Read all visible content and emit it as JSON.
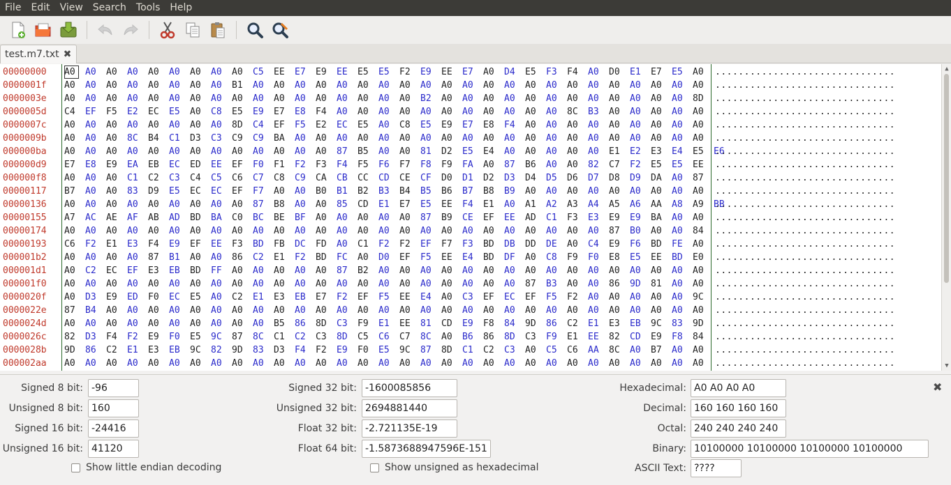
{
  "menu": [
    "File",
    "Edit",
    "View",
    "Search",
    "Tools",
    "Help"
  ],
  "toolbar": {
    "icons": [
      "new-file-icon",
      "open-file-icon",
      "save-file-icon",
      "undo-icon",
      "redo-icon",
      "cut-icon",
      "copy-icon",
      "paste-icon",
      "find-icon",
      "find-replace-icon"
    ]
  },
  "tab": {
    "title": "test.m7.txt",
    "close_glyph": "✖"
  },
  "hex": {
    "rows": [
      {
        "offset": "00000000",
        "bytes": "A0 A0 A0 A0 A0 A0 A0 A0 A0 C5 EE E7 E9 EE E5 E5 F2 E9 EE E7 A0 D4 E5 F3 F4 A0 D0 E1 E7 E5 A0",
        "ascii": "..............................."
      },
      {
        "offset": "0000001f",
        "bytes": "A0 A0 A0 A0 A0 A0 A0 A0 B1 A0 A0 A0 A0 A0 A0 A0 A0 A0 A0 A0 A0 A0 A0 A0 A0 A0 A0 A0 A0 A0 A0",
        "ascii": "..............................."
      },
      {
        "offset": "0000003e",
        "bytes": "A0 A0 A0 A0 A0 A0 A0 A0 A0 A0 A0 A0 A0 A0 A0 A0 A0 B2 A0 A0 A0 A0 A0 A0 A0 A0 A0 A0 A0 A0 8D",
        "ascii": "..............................."
      },
      {
        "offset": "0000005d",
        "bytes": "C4 EF F5 E2 EC E5 A0 C8 E5 E9 E7 E8 F4 A0 A0 A0 A0 A0 A0 A0 A0 A0 A0 A0 8C B3 A0 A0 A0 A0 A0",
        "ascii": "..............................."
      },
      {
        "offset": "0000007c",
        "bytes": "A0 A0 A0 A0 A0 A0 A0 A0 8D C4 EF F5 E2 EC E5 A0 C8 E5 E9 E7 E8 F4 A0 A0 A0 A0 A0 A0 A0 A0 A0",
        "ascii": "..............................."
      },
      {
        "offset": "0000009b",
        "bytes": "A0 A0 A0 8C B4 C1 D3 C3 C9 C9 BA A0 A0 A0 A0 A0 A0 A0 A0 A0 A0 A0 A0 A0 A0 A0 A0 A0 A0 A0 A0",
        "ascii": "..............................."
      },
      {
        "offset": "000000ba",
        "bytes": "A0 A0 A0 A0 A0 A0 A0 A0 A0 A0 A0 A0 A0 87 B5 A0 A0 81 D2 E5 E4 A0 A0 A0 A0 A0 E1 E2 E3 E4 E5 E6",
        "ascii": "..............................."
      },
      {
        "offset": "000000d9",
        "bytes": "E7 E8 E9 EA EB EC ED EE EF F0 F1 F2 F3 F4 F5 F6 F7 F8 F9 FA A0 87 B6 A0 A0 82 C7 F2 E5 E5 EE",
        "ascii": "..............................."
      },
      {
        "offset": "000000f8",
        "bytes": "A0 A0 A0 C1 C2 C3 C4 C5 C6 C7 C8 C9 CA CB CC CD CE CF D0 D1 D2 D3 D4 D5 D6 D7 D8 D9 DA A0 87",
        "ascii": "..............................."
      },
      {
        "offset": "00000117",
        "bytes": "B7 A0 A0 83 D9 E5 EC EC EF F7 A0 A0 B0 B1 B2 B3 B4 B5 B6 B7 B8 B9 A0 A0 A0 A0 A0 A0 A0 A0 A0",
        "ascii": "..............................."
      },
      {
        "offset": "00000136",
        "bytes": "A0 A0 A0 A0 A0 A0 A0 A0 A0 87 B8 A0 A0 85 CD E1 E7 E5 EE F4 E1 A0 A1 A2 A3 A4 A5 A6 AA A8 A9 BB",
        "ascii": "..............................."
      },
      {
        "offset": "00000155",
        "bytes": "A7 AC AE AF AB AD BD BA C0 BC BE BF A0 A0 A0 A0 A0 87 B9 CE EF EE AD C1 F3 E3 E9 E9 BA A0 A0",
        "ascii": "..............................."
      },
      {
        "offset": "00000174",
        "bytes": "A0 A0 A0 A0 A0 A0 A0 A0 A0 A0 A0 A0 A0 A0 A0 A0 A0 A0 A0 A0 A0 A0 A0 A0 A0 A0 87 B0 A0 A0 84",
        "ascii": "..............................."
      },
      {
        "offset": "00000193",
        "bytes": "C6 F2 E1 E3 F4 E9 EF EE F3 BD FB DC FD A0 C1 F2 F2 EF F7 F3 BD DB DD DE A0 C4 E9 F6 BD FE A0",
        "ascii": "..............................."
      },
      {
        "offset": "000001b2",
        "bytes": "A0 A0 A0 A0 87 B1 A0 A0 86 C2 E1 F2 BD FC A0 D0 EF F5 EE E4 BD DF A0 C8 F9 F0 E8 E5 EE BD E0",
        "ascii": "..............................."
      },
      {
        "offset": "000001d1",
        "bytes": "A0 C2 EC EF E3 EB BD FF A0 A0 A0 A0 A0 87 B2 A0 A0 A0 A0 A0 A0 A0 A0 A0 A0 A0 A0 A0 A0 A0 A0",
        "ascii": "..............................."
      },
      {
        "offset": "000001f0",
        "bytes": "A0 A0 A0 A0 A0 A0 A0 A0 A0 A0 A0 A0 A0 A0 A0 A0 A0 A0 A0 A0 A0 A0 87 B3 A0 A0 86 9D 81 A0 A0",
        "ascii": "..............................."
      },
      {
        "offset": "0000020f",
        "bytes": "A0 D3 E9 ED F0 EC E5 A0 C2 E1 E3 EB E7 F2 EF F5 EE E4 A0 C3 EF EC EF F5 F2 A0 A0 A0 A0 A0 9C",
        "ascii": "..............................."
      },
      {
        "offset": "0000022e",
        "bytes": "87 B4 A0 A0 A0 A0 A0 A0 A0 A0 A0 A0 A0 A0 A0 A0 A0 A0 A0 A0 A0 A0 A0 A0 A0 A0 A0 A0 A0 A0 A0",
        "ascii": "..............................."
      },
      {
        "offset": "0000024d",
        "bytes": "A0 A0 A0 A0 A0 A0 A0 A0 A0 A0 B5 86 8D C3 F9 E1 EE 81 CD E9 F8 84 9D 86 C2 E1 E3 EB 9C 83 9D",
        "ascii": "..............................."
      },
      {
        "offset": "0000026c",
        "bytes": "82 D3 F4 F2 E9 F0 E5 9C 87 8C C1 C2 C3 8D C5 C6 C7 8C A0 B6 86 8D C3 F9 E1 EE 82 CD E9 F8 84",
        "ascii": "..............................."
      },
      {
        "offset": "0000028b",
        "bytes": "9D 86 C2 E1 E3 EB 9C 82 9D 83 D3 F4 F2 E9 F0 E5 9C 87 8D C1 C2 C3 A0 C5 C6 AA 8C A0 B7 A0 A0",
        "ascii": "..............................."
      },
      {
        "offset": "000002aa",
        "bytes": "A0 A0 A0 A0 A0 A0 A0 A0 A0 A0 A0 A0 A0 A0 A0 A0 A0 A0 A0 A0 A0 A0 A0 A0 A0 A0 A0 A0 A0 A0 A0",
        "ascii": "..............................."
      }
    ]
  },
  "panel": {
    "signed8_label": "Signed 8 bit:",
    "signed8": "-96",
    "unsigned8_label": "Unsigned 8 bit:",
    "unsigned8": "160",
    "signed16_label": "Signed 16 bit:",
    "signed16": "-24416",
    "unsigned16_label": "Unsigned 16 bit:",
    "unsigned16": "41120",
    "signed32_label": "Signed 32 bit:",
    "signed32": "-1600085856",
    "unsigned32_label": "Unsigned 32 bit:",
    "unsigned32": "2694881440",
    "float32_label": "Float 32 bit:",
    "float32": "-2.721135E-19",
    "float64_label": "Float 64 bit:",
    "float64": "-1.5873688947596E-151",
    "hex_label": "Hexadecimal:",
    "hex": "A0 A0 A0 A0",
    "dec_label": "Decimal:",
    "dec": "160 160 160 160",
    "oct_label": "Octal:",
    "oct": "240 240 240 240",
    "bin_label": "Binary:",
    "bin": "10100000 10100000 10100000 10100000",
    "ascii_label": "ASCII Text:",
    "ascii": "????",
    "little_endian_label": "Show little endian decoding",
    "unsigned_hex_label": "Show unsigned as hexadecimal",
    "close_glyph": "✖"
  }
}
